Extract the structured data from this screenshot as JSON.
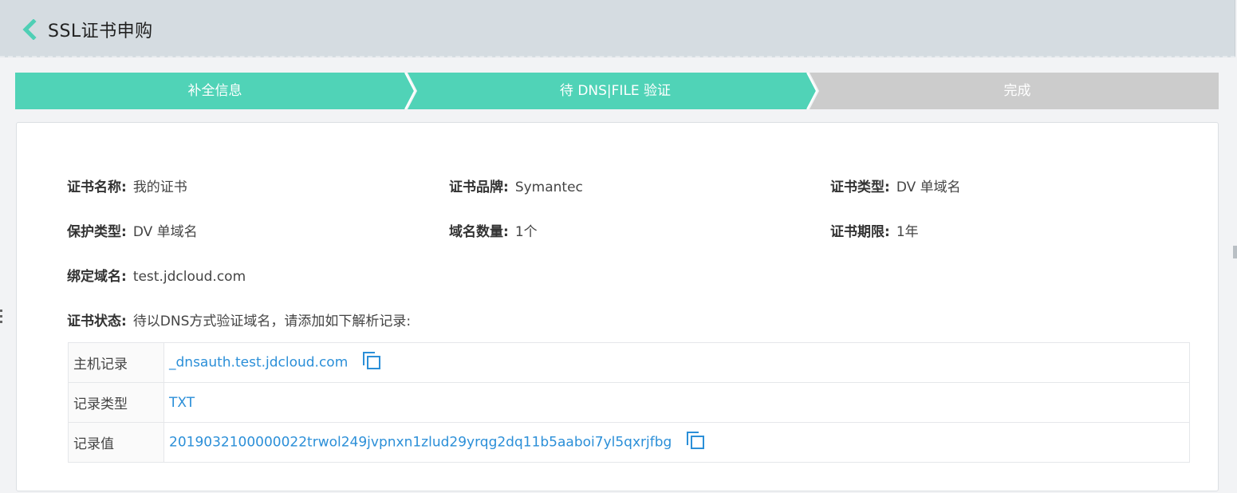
{
  "header": {
    "title": "SSL证书申购",
    "back_icon": "chevron-left-icon",
    "back_color": "#4fcfb5"
  },
  "steps": [
    {
      "label": "补全信息",
      "state": "done"
    },
    {
      "label": "待 DNS|FILE 验证",
      "state": "active"
    },
    {
      "label": "完成",
      "state": "pending"
    }
  ],
  "colors": {
    "step_active": "#50d3b7",
    "step_pending": "#cccccc",
    "link": "#2b8fd8"
  },
  "info": {
    "cert_name": {
      "label": "证书名称:",
      "value": "我的证书"
    },
    "cert_brand": {
      "label": "证书品牌:",
      "value": "Symantec"
    },
    "cert_type": {
      "label": "证书类型:",
      "value": "DV 单域名"
    },
    "protect_type": {
      "label": "保护类型:",
      "value": "DV 单域名"
    },
    "domain_count": {
      "label": "域名数量:",
      "value": "1个"
    },
    "cert_period": {
      "label": "证书期限:",
      "value": "1年"
    },
    "bound_domain": {
      "label": "绑定域名:",
      "value": "test.jdcloud.com"
    },
    "cert_status": {
      "label": "证书状态:",
      "value": "待以DNS方式验证域名，请添加如下解析记录:"
    }
  },
  "records": [
    {
      "label": "主机记录",
      "value": "_dnsauth.test.jdcloud.com",
      "copy": true
    },
    {
      "label": "记录类型",
      "value": "TXT",
      "copy": false
    },
    {
      "label": "记录值",
      "value": "2019032100000022trwol249jvpnxn1zlud29yrqg2dq11b5aaboi7yl5qxrjfbg",
      "copy": true
    }
  ]
}
